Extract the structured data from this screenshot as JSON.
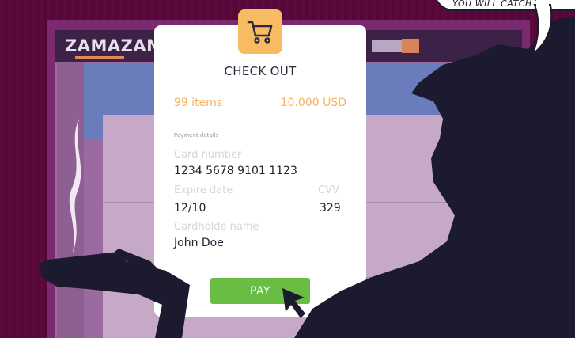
{
  "speech_bubble": {
    "text": "YOU WILL CATCH TH"
  },
  "store": {
    "logo": "ZAMAZAN"
  },
  "checkout": {
    "icon": "shopping-cart-icon",
    "title": "CHECK OUT",
    "items": "99 items",
    "total": "10.000 USD",
    "section_label": "Payment details",
    "card_number_label": "Card number",
    "card_number": "1234 5678 9101 1123",
    "expire_label": "Expire date",
    "expire_value": "12/10",
    "cvv_label": "CVV",
    "cvv_value": "329",
    "holder_label": "Cardholde name",
    "holder_value": "John Doe",
    "pay_label": "PAY"
  },
  "colors": {
    "background": "#5b0a3c",
    "accent_orange": "#f7bb62",
    "pay_green": "#69bd45",
    "silhouette": "#1b1a2e",
    "banner_blue": "#6a7cbc"
  }
}
